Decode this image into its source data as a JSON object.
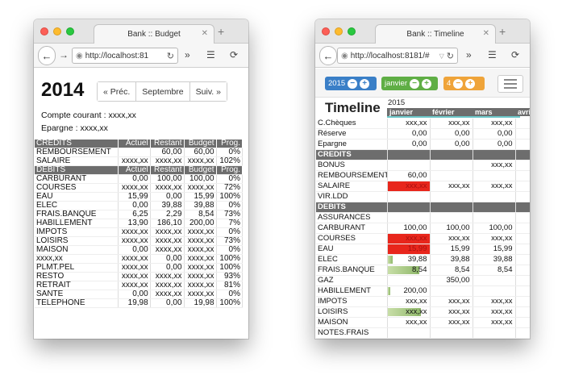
{
  "budget_window": {
    "tab_title": "Bank :: Budget",
    "url": "http://localhost:81",
    "year": "2014",
    "prev_label": "« Préc.",
    "month_label": "Septembre",
    "next_label": "Suiv. »",
    "compte_courant": "Compte courant : xxxx,xx",
    "epargne": "Epargne : xxxx,xx",
    "credits_header": [
      "CREDITS",
      "Actuel",
      "Restant",
      "Budget",
      "Prog."
    ],
    "credits_rows": [
      [
        "REMBOURSEMENT",
        "",
        "60,00",
        "60,00",
        "0%"
      ],
      [
        "SALAIRE",
        "xxxx,xx",
        "xxxx,xx",
        "xxxx,xx",
        "102%"
      ]
    ],
    "debits_header": [
      "DEBITS",
      "Actuel",
      "Restant",
      "Budget",
      "Prog."
    ],
    "debits_rows": [
      [
        "CARBURANT",
        "0,00",
        "100,00",
        "100,00",
        "0%"
      ],
      [
        "COURSES",
        "xxxx,xx",
        "xxxx,xx",
        "xxxx,xx",
        "72%"
      ],
      [
        "EAU",
        "15,99",
        "0,00",
        "15,99",
        "100%"
      ],
      [
        "ELEC",
        "0,00",
        "39,88",
        "39,88",
        "0%"
      ],
      [
        "FRAIS.BANQUE",
        "6,25",
        "2,29",
        "8,54",
        "73%"
      ],
      [
        "HABILLEMENT",
        "13,90",
        "186,10",
        "200,00",
        "7%"
      ],
      [
        "IMPOTS",
        "xxxx,xx",
        "xxxx,xx",
        "xxxx,xx",
        "0%"
      ],
      [
        "LOISIRS",
        "xxxx,xx",
        "xxxx,xx",
        "xxxx,xx",
        "73%"
      ],
      [
        "MAISON",
        "0,00",
        "xxxx,xx",
        "xxxx,xx",
        "0%"
      ],
      [
        "xxxx,xx",
        "xxxx,xx",
        "0,00",
        "xxxx,xx",
        "100%"
      ],
      [
        "PLMT.PEL",
        "xxxx,xx",
        "0,00",
        "xxxx,xx",
        "100%"
      ],
      [
        "RESTO",
        "xxxx,xx",
        "xxxx,xx",
        "xxxx,xx",
        "93%"
      ],
      [
        "RETRAIT",
        "xxxx,xx",
        "xxxx,xx",
        "xxxx,xx",
        "81%"
      ],
      [
        "SANTE",
        "0,00",
        "xxxx,xx",
        "xxxx,xx",
        "0%"
      ],
      [
        "TELEPHONE",
        "19,98",
        "0,00",
        "19,98",
        "100%"
      ]
    ]
  },
  "timeline_window": {
    "tab_title": "Bank :: Timeline",
    "url": "http://localhost:8181/#",
    "year_control": "2015",
    "month_control": "janvier",
    "count_control": "4",
    "title": "Timeline",
    "year_label": "2015",
    "months": [
      "janvier",
      "février",
      "mars",
      "avri"
    ],
    "rows": [
      {
        "type": "row",
        "label": "C.Chèques",
        "cells": [
          "xxx,xx",
          "xxx,xx",
          "xxx,xx"
        ]
      },
      {
        "type": "row",
        "label": "Réserve",
        "cells": [
          "0,00",
          "0,00",
          "0,00"
        ]
      },
      {
        "type": "row",
        "label": "Epargne",
        "cells": [
          "0,00",
          "0,00",
          "0,00"
        ]
      },
      {
        "type": "section",
        "label": "CREDITS"
      },
      {
        "type": "row",
        "label": "BONUS",
        "cells": [
          "",
          "",
          "xxx,xx"
        ]
      },
      {
        "type": "row",
        "label": "REMBOURSEMENT",
        "cells": [
          "60,00",
          "",
          ""
        ]
      },
      {
        "type": "row",
        "label": "SALAIRE",
        "cells": [
          "xxx,xx",
          "xxx,xx",
          "xxx,xx"
        ],
        "red": [
          0
        ]
      },
      {
        "type": "row",
        "label": "VIR.LDD",
        "cells": [
          "",
          "",
          ""
        ]
      },
      {
        "type": "section",
        "label": "DEBITS"
      },
      {
        "type": "row",
        "label": "ASSURANCES",
        "cells": [
          "",
          "",
          ""
        ]
      },
      {
        "type": "row",
        "label": "CARBURANT",
        "cells": [
          "100,00",
          "100,00",
          "100,00"
        ]
      },
      {
        "type": "row",
        "label": "COURSES",
        "cells": [
          "xxx,xx",
          "xxx,xx",
          "xxx,xx"
        ],
        "red": [
          0
        ]
      },
      {
        "type": "row",
        "label": "EAU",
        "cells": [
          "15,99",
          "15,99",
          "15,99"
        ],
        "red": [
          0
        ]
      },
      {
        "type": "row",
        "label": "ELEC",
        "cells": [
          "39,88",
          "39,88",
          "39,88"
        ],
        "bar": {
          "0": 0.12
        }
      },
      {
        "type": "row",
        "label": "FRAIS.BANQUE",
        "cells": [
          "8,54",
          "8,54",
          "8,54"
        ],
        "bar": {
          "0": 0.75
        }
      },
      {
        "type": "row",
        "label": "GAZ",
        "cells": [
          "",
          "350,00",
          ""
        ]
      },
      {
        "type": "row",
        "label": "HABILLEMENT",
        "cells": [
          "200,00",
          "",
          ""
        ],
        "bar": {
          "0": 0.07
        }
      },
      {
        "type": "row",
        "label": "IMPOTS",
        "cells": [
          "xxx,xx",
          "xxx,xx",
          "xxx,xx"
        ]
      },
      {
        "type": "row",
        "label": "LOISIRS",
        "cells": [
          "xxx,xx",
          "xxx,xx",
          "xxx,xx"
        ],
        "bar": {
          "0": 0.8
        }
      },
      {
        "type": "row",
        "label": "MAISON",
        "cells": [
          "xxx,xx",
          "xxx,xx",
          "xxx,xx"
        ]
      },
      {
        "type": "row",
        "label": "NOTES.FRAIS",
        "cells": [
          "",
          "",
          ""
        ]
      }
    ]
  },
  "colors": {
    "header_bg": "#6d6d6d",
    "over_budget_red": "#e8261c",
    "progress_green": "#8fb86a",
    "year_pill": "#3a7fc7",
    "month_pill": "#5fae45",
    "count_pill": "#efa43a"
  }
}
